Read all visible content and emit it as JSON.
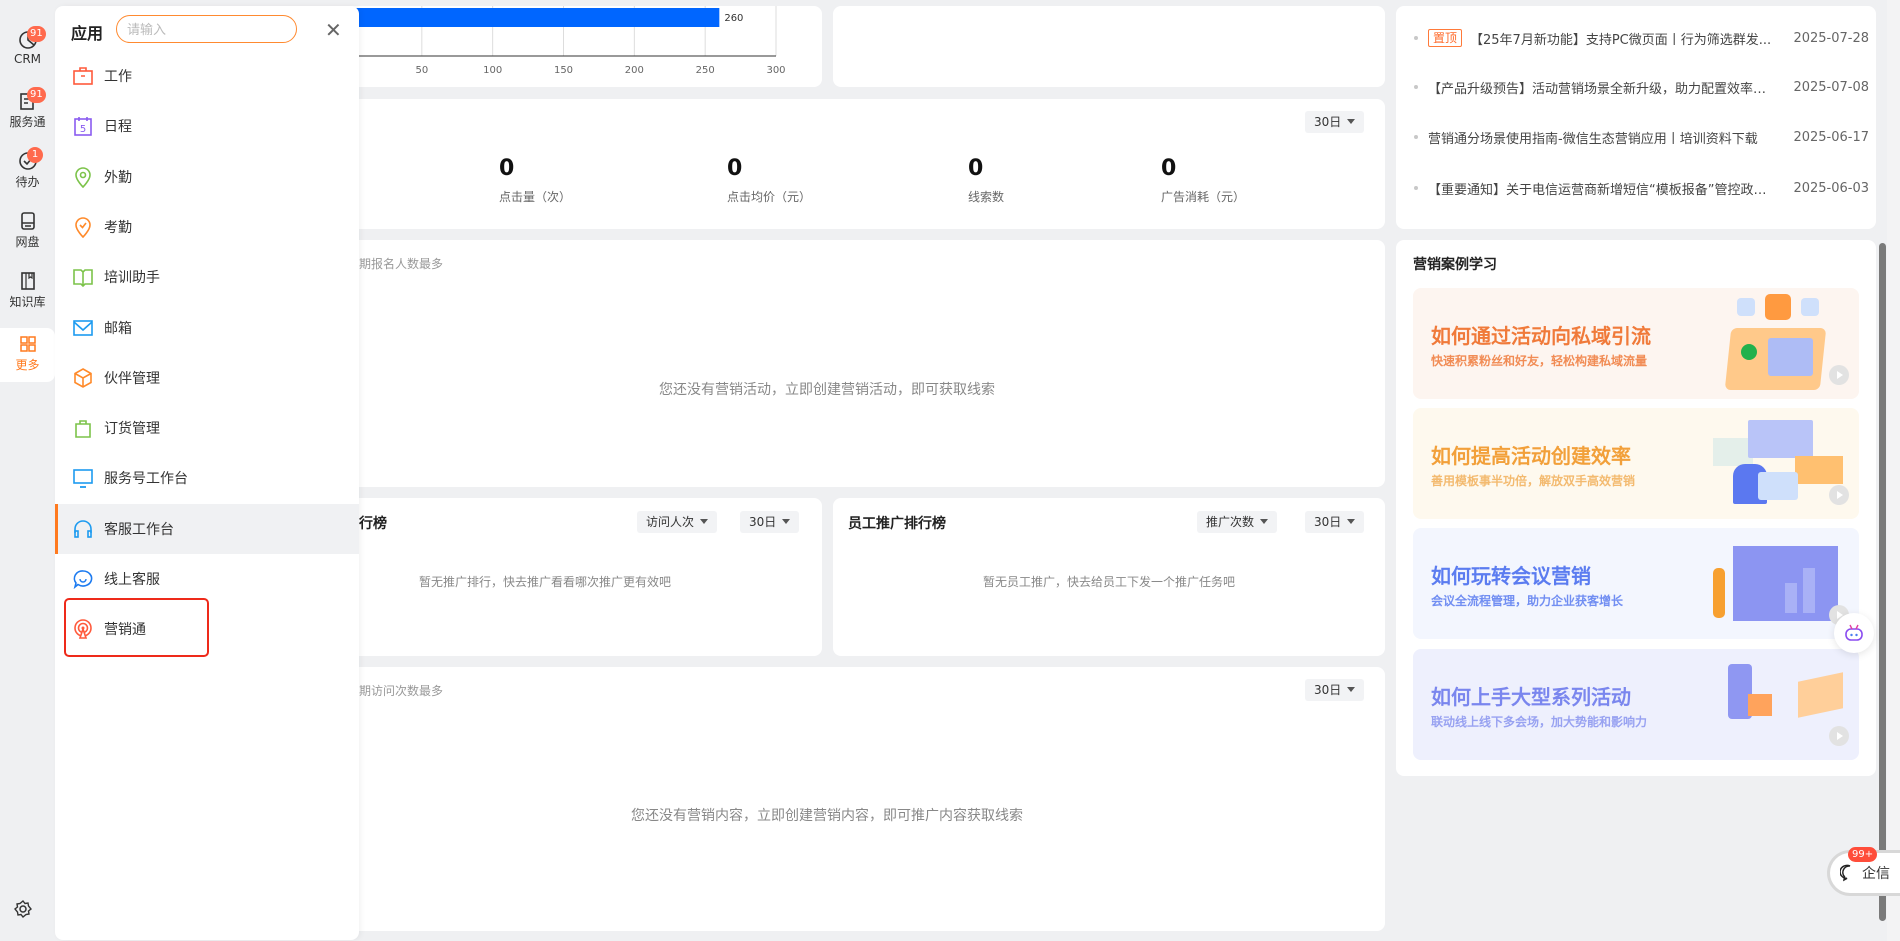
{
  "rail": {
    "items": [
      {
        "label": "CRM",
        "badge": "91",
        "icon": "pie-chart-icon"
      },
      {
        "label": "服务通",
        "badge": "91",
        "icon": "service-doc-icon"
      },
      {
        "label": "待办",
        "badge": "1",
        "icon": "check-circle-icon"
      },
      {
        "label": "网盘",
        "badge": "",
        "icon": "disk-icon"
      },
      {
        "label": "知识库",
        "badge": "",
        "icon": "book-icon"
      },
      {
        "label": "更多",
        "badge": "",
        "icon": "grid-icon",
        "active": true
      }
    ],
    "settings_icon": "gear-icon"
  },
  "drawer": {
    "title": "应用",
    "search_placeholder": "请输入",
    "close": "✕",
    "items": [
      {
        "label": "工作",
        "icon": "briefcase-icon",
        "color": "#ff5a3c"
      },
      {
        "label": "日程",
        "icon": "calendar-icon",
        "color": "#8a5cf0"
      },
      {
        "label": "外勤",
        "icon": "location-icon",
        "color": "#7cc34a"
      },
      {
        "label": "考勤",
        "icon": "checkin-location-icon",
        "color": "#ff8a2a"
      },
      {
        "label": "培训助手",
        "icon": "open-book-icon",
        "color": "#7cc34a"
      },
      {
        "label": "邮箱",
        "icon": "mail-icon",
        "color": "#1d9bf0"
      },
      {
        "label": "伙伴管理",
        "icon": "box-icon",
        "color": "#ff8a2a"
      },
      {
        "label": "订货管理",
        "icon": "shopping-bag-icon",
        "color": "#7cc34a"
      },
      {
        "label": "服务号工作台",
        "icon": "monitor-icon",
        "color": "#1d9bf0"
      },
      {
        "label": "客服工作台",
        "icon": "headset-icon",
        "color": "#1d9bf0",
        "highlighted": true
      },
      {
        "label": "线上客服",
        "icon": "chat-smile-icon",
        "color": "#1d7bf0"
      },
      {
        "label": "营销通",
        "icon": "broadcast-icon",
        "color": "#ff5a3c",
        "boxed": true
      }
    ]
  },
  "main": {
    "chart": {
      "type": "bar",
      "value_label": "260",
      "value": 260,
      "ticks": [
        "50",
        "100",
        "150",
        "200",
        "250",
        "300"
      ],
      "xlim": [
        0,
        300
      ],
      "bar_color": "#0066ff"
    },
    "stats": {
      "period": "30日",
      "items": [
        {
          "value": "0",
          "label": "点击量（次）"
        },
        {
          "value": "0",
          "label": "点击均价（元）"
        },
        {
          "value": "0",
          "label": "线索数"
        },
        {
          "value": "0",
          "label": "广告消耗（元）"
        }
      ]
    },
    "activity": {
      "subtitle": "期报名人数最多",
      "empty": "您还没有营销活动，立即创建营销活动，即可获取线索"
    },
    "rank1": {
      "title": "行榜",
      "metric": "访问人次",
      "period": "30日",
      "empty": "暂无推广排行，快去推广看看哪次推广更有效吧"
    },
    "rank2": {
      "title": "员工推广排行榜",
      "metric": "推广次数",
      "period": "30日",
      "empty": "暂无员工推广，快去给员工下发一个推广任务吧"
    },
    "content": {
      "subtitle": "期访问次数最多",
      "period": "30日",
      "empty": "您还没有营销内容，立即创建营销内容，即可推广内容获取线索"
    }
  },
  "notices": [
    {
      "pin": "置顶",
      "text": "【25年7月新功能】支持PC微页面丨行为筛选群发...",
      "date": "2025-07-28"
    },
    {
      "pin": "",
      "text": "【产品升级预告】活动营销场景全新升级，助力配置效率与...",
      "date": "2025-07-08"
    },
    {
      "pin": "",
      "text": "营销通分场景使用指南-微信生态营销应用丨培训资料下载",
      "date": "2025-06-17"
    },
    {
      "pin": "",
      "text": "【重要通知】关于电信运营商新增短信“模板报备”管控政策...",
      "date": "2025-06-03"
    }
  ],
  "cases": {
    "title": "营销案例学习",
    "items": [
      {
        "title": "如何通过活动向私域引流",
        "sub": "快速积累粉丝和好友，轻松构建私域流量",
        "color": "#f07a3a",
        "bg": "#fdf5f0"
      },
      {
        "title": "如何提高活动创建效率",
        "sub": "善用模板事半功倍，解放双手高效营销",
        "color": "#f2a03a",
        "bg": "#fef9ee"
      },
      {
        "title": "如何玩转会议营销",
        "sub": "会议全流程管理，助力企业获客增长",
        "color": "#5b7cf0",
        "bg": "#f3f6fe"
      },
      {
        "title": "如何上手大型系列活动",
        "sub": "联动线上线下多会场，加大势能和影响力",
        "color": "#7a86ee",
        "bg": "#eef0fd"
      }
    ]
  },
  "float": {
    "assistant_icon": "robot-icon",
    "chat_label": "企信",
    "chat_badge": "99+"
  }
}
